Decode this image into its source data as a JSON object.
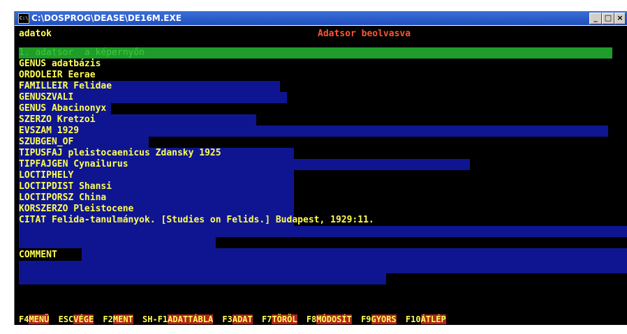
{
  "window": {
    "title": "C:\\DOSPROG\\DEASE\\DE16M.EXE",
    "min": "_",
    "max": "□",
    "close": "×"
  },
  "console": {
    "top_left": "adatok",
    "top_center": "Adatsor beolvasva",
    "status_line": "1. adatsor  a képernyőn",
    "fields": [
      "GENUS adatbázis",
      "ORDOLEIR Eerae",
      "FAMILLEIR Felidae",
      "GENUSZVALI",
      "GENUS Abacinonyx",
      "SZERZO Kretzoi",
      "EVSZAM 1929",
      "SZUBGEN_OF",
      "TIPUSFAJ pleistocaenicus Zdansky 1925",
      "TIPFAJGEN Cynailurus",
      "LOCTIPHELY",
      "LOCTIPDIST Shansi",
      "LOCTIPORSZ China",
      "KORSZERZO Pleistocene",
      "CITAT Felida-tanulmányok. [Studies on Felids.] Budapest, 1929:11."
    ],
    "comment_label": "COMMENT"
  },
  "fkeys": [
    {
      "key": "F4",
      "label": "MENÜ"
    },
    {
      "key": "ESC",
      "label": "VÉGE"
    },
    {
      "key": "F2",
      "label": "MENT"
    },
    {
      "key": "SH-F1",
      "label": "ADATTÁBLA"
    },
    {
      "key": "F3",
      "label": "ADAT"
    },
    {
      "key": "F7",
      "label": "TÖRÖL"
    },
    {
      "key": "F8",
      "label": "MÓDOSÍT"
    },
    {
      "key": "F9",
      "label": "GYORS"
    },
    {
      "key": "F10",
      "label": "ÁTLÉP"
    }
  ]
}
